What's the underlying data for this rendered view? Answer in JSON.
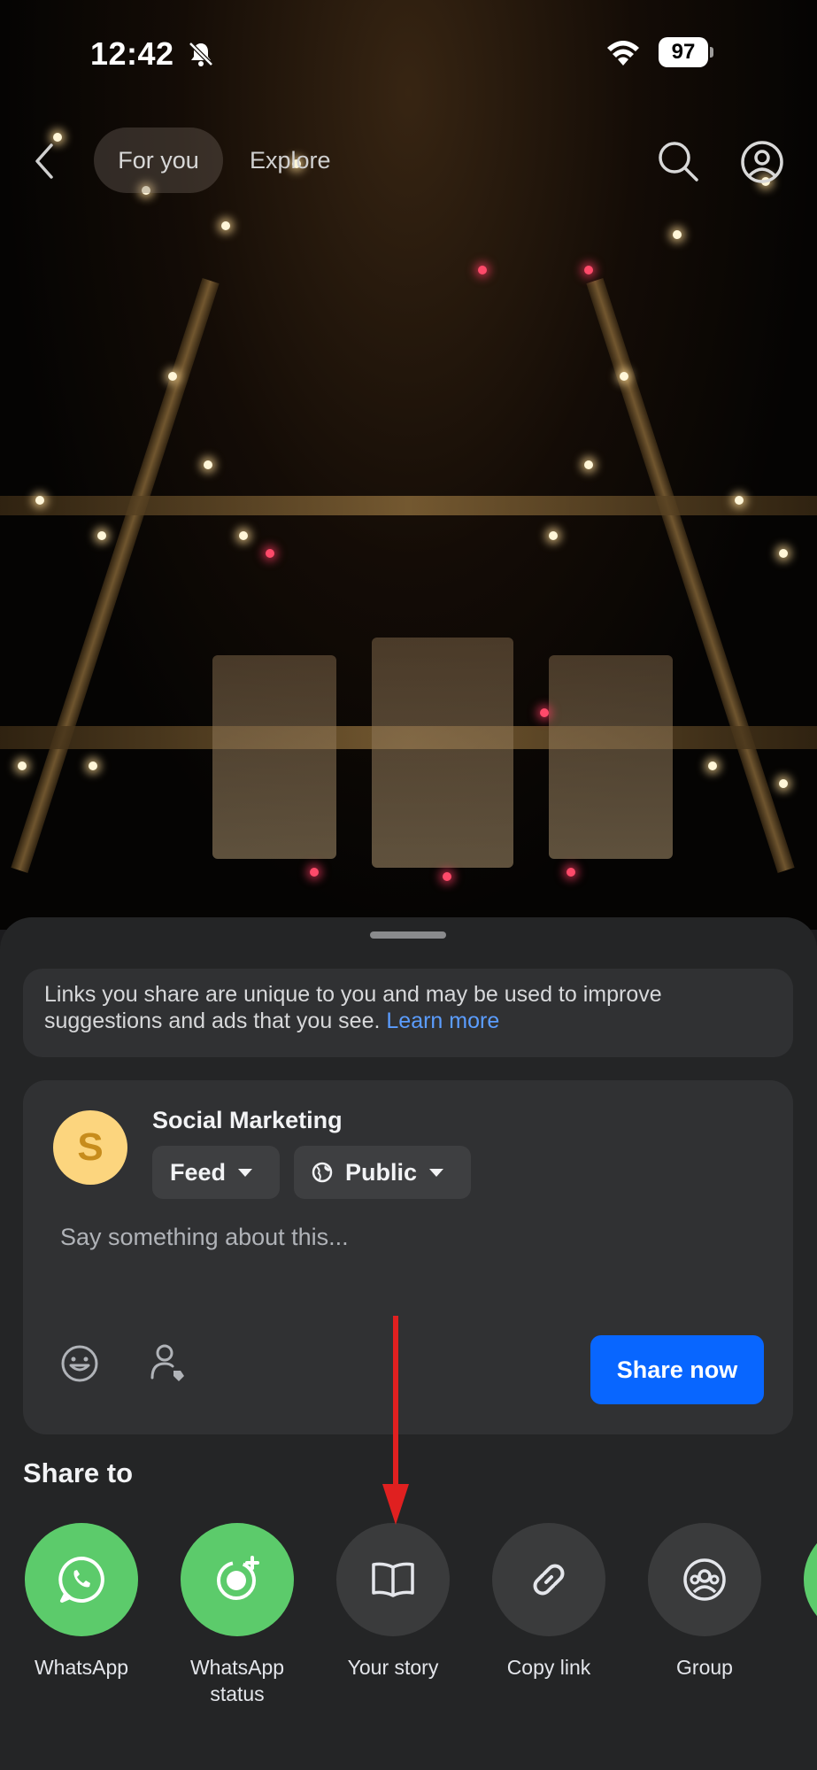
{
  "status_bar": {
    "time": "12:42",
    "battery": "97"
  },
  "top_nav": {
    "tab_for_you": "For you",
    "tab_explore": "Explore"
  },
  "share_sheet": {
    "notice_text": "Links you share are unique to you and may be used to improve suggestions and ads that you see. ",
    "notice_link": "Learn more",
    "composer": {
      "avatar_letter": "S",
      "page_name": "Social Marketing",
      "destination": "Feed",
      "audience": "Public",
      "placeholder": "Say something about this...",
      "share_button": "Share now"
    },
    "share_to_title": "Share to",
    "targets": [
      {
        "label": "WhatsApp",
        "icon": "whatsapp-icon"
      },
      {
        "label": "WhatsApp status",
        "icon": "whatsapp-status-icon"
      },
      {
        "label": "Your story",
        "icon": "book-icon"
      },
      {
        "label": "Copy link",
        "icon": "link-icon"
      },
      {
        "label": "Group",
        "icon": "group-icon"
      }
    ]
  },
  "colors": {
    "sheet_bg": "#242526",
    "card_bg": "#303133",
    "primary_button": "#0866ff",
    "whatsapp_green": "#5ccb6b",
    "link_blue": "#5b9dff",
    "annotation_arrow": "#e02020"
  }
}
